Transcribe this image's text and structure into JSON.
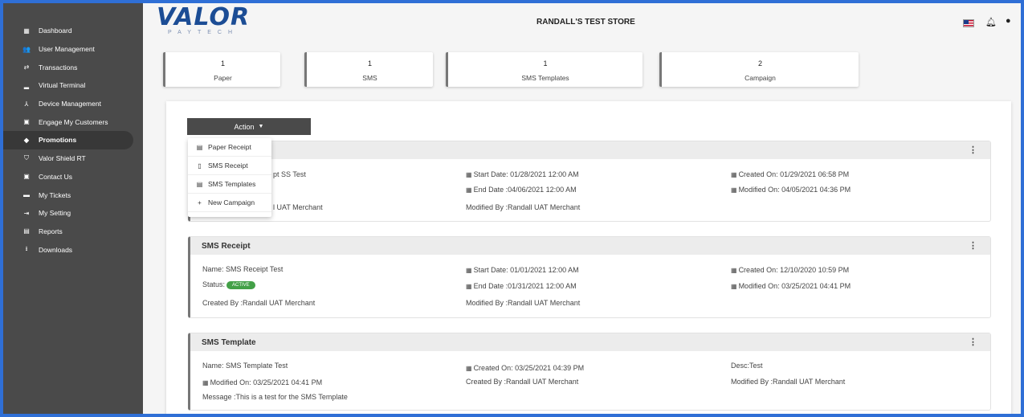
{
  "sidebar": {
    "items": [
      {
        "label": "Dashboard",
        "icon": "dashboard-icon",
        "glyph": "▦"
      },
      {
        "label": "User Management",
        "icon": "users-icon",
        "glyph": "👥"
      },
      {
        "label": "Transactions",
        "icon": "transactions-icon",
        "glyph": "⇄"
      },
      {
        "label": "Virtual Terminal",
        "icon": "terminal-icon",
        "glyph": "▂"
      },
      {
        "label": "Device Management",
        "icon": "device-icon",
        "glyph": "⅄"
      },
      {
        "label": "Engage My Customers",
        "icon": "engage-icon",
        "glyph": "▣"
      },
      {
        "label": "Promotions",
        "icon": "tag-icon",
        "glyph": "◆"
      },
      {
        "label": "Valor Shield RT",
        "icon": "shield-icon",
        "glyph": "⛉"
      },
      {
        "label": "Contact Us",
        "icon": "contact-icon",
        "glyph": "▣"
      },
      {
        "label": "My Tickets",
        "icon": "ticket-icon",
        "glyph": "▬"
      },
      {
        "label": "My Setting",
        "icon": "setting-icon",
        "glyph": "⇥"
      },
      {
        "label": "Reports",
        "icon": "report-icon",
        "glyph": "▤"
      },
      {
        "label": "Downloads",
        "icon": "download-icon",
        "glyph": "⭳"
      }
    ],
    "active_index": 6
  },
  "header": {
    "logo_main": "VALOR",
    "logo_sub": "PAYTECH",
    "store_name": "RANDALL'S TEST STORE"
  },
  "stats": [
    {
      "num": "1",
      "label": "Paper"
    },
    {
      "num": "1",
      "label": "SMS"
    },
    {
      "num": "1",
      "label": "SMS Templates"
    },
    {
      "num": "2",
      "label": "Campaign"
    }
  ],
  "action": {
    "label": "Action",
    "menu": [
      {
        "label": "Paper Receipt",
        "icon": "receipt-icon",
        "glyph": "▤"
      },
      {
        "label": "SMS Receipt",
        "icon": "phone-icon",
        "glyph": "▯"
      },
      {
        "label": "SMS Templates",
        "icon": "template-icon",
        "glyph": "▤"
      },
      {
        "label": "New Campaign",
        "icon": "plus-icon",
        "glyph": "+"
      }
    ]
  },
  "sections": {
    "paper": {
      "title": "",
      "name_partial": "pt SS Test",
      "created_partial": "l UAT Merchant",
      "start_date": "Start Date: 01/28/2021 12:00 AM",
      "end_date": "End Date :04/06/2021 12:00 AM",
      "modified_by": "Modified By :Randall UAT Merchant",
      "created_on": "Created On: 01/29/2021 06:58 PM",
      "modified_on": "Modified On: 04/05/2021 04:36 PM"
    },
    "sms": {
      "title": "SMS Receipt",
      "name": "Name: SMS Receipt Test",
      "status_label": "Status:",
      "status": "ACTIVE",
      "created_by": "Created By :Randall UAT Merchant",
      "start_date": "Start Date: 01/01/2021 12:00 AM",
      "end_date": "End Date :01/31/2021 12:00 AM",
      "modified_by": "Modified By :Randall UAT Merchant",
      "created_on": "Created On: 12/10/2020 10:59 PM",
      "modified_on": "Modified On: 03/25/2021 04:41 PM"
    },
    "template": {
      "title": "SMS Template",
      "name": "Name: SMS Template Test",
      "modified_on": "Modified On: 03/25/2021 04:41 PM",
      "message": "Message :This is a test for the SMS Template",
      "created_on": "Created On: 03/25/2021 04:39 PM",
      "created_by": "Created By :Randall UAT Merchant",
      "desc": "Desc:Test",
      "modified_by": "Modified By :Randall UAT Merchant"
    }
  },
  "colors": {
    "accent": "#2f6fd6",
    "sidebar": "#4a4a4a",
    "active_badge": "#43a047",
    "logo": "#1c4d95"
  }
}
